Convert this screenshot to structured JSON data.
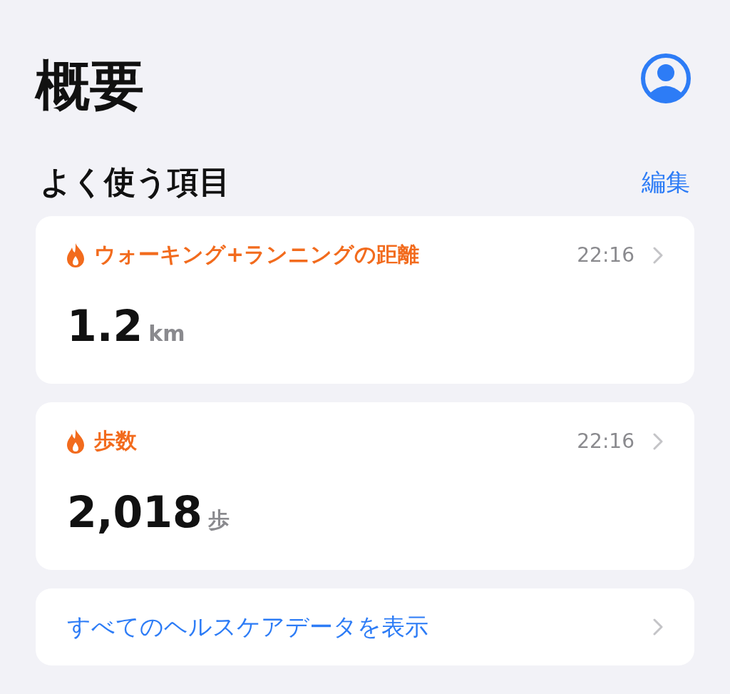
{
  "title": "概要",
  "section": {
    "heading": "よく使う項目",
    "edit": "編集"
  },
  "cards": [
    {
      "title": "ウォーキング+ランニングの距離",
      "time": "22:16",
      "value": "1.2",
      "unit": "km"
    },
    {
      "title": "歩数",
      "time": "22:16",
      "value": "2,018",
      "unit": "歩"
    }
  ],
  "link": {
    "label": "すべてのヘルスケアデータを表示"
  }
}
